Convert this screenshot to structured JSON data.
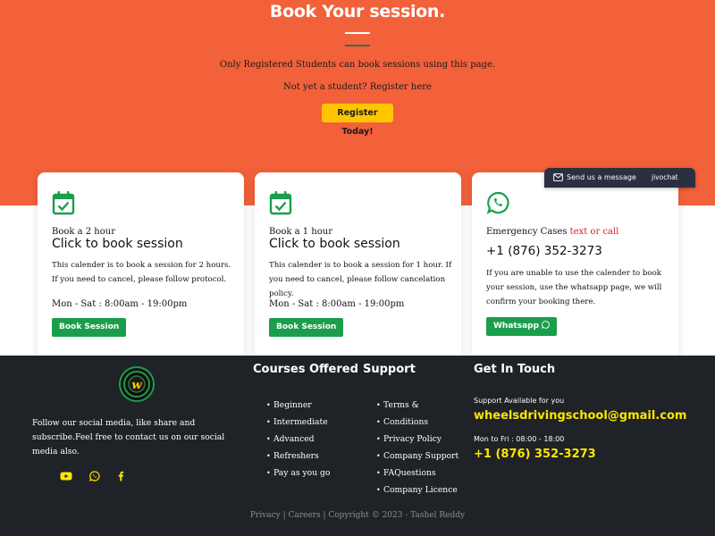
{
  "hero": {
    "title": "Book Your session.",
    "line1": "Only Registered Students can book sessions using this page.",
    "line2": "Not yet a student? Register here",
    "register_button": "Register Today!"
  },
  "cards": [
    {
      "icon": "calendar-check-icon",
      "small": "Book a 2 hour",
      "big": "Click to book session",
      "text": "This calender is to book a session for 2 hours. If you need to cancel, please follow protocol.",
      "hours": "Mon - Sat : 8:00am - 19:00pm",
      "button": "Book Session"
    },
    {
      "icon": "calendar-check-icon",
      "small": "Book a 1 hour",
      "big": "Click to book session",
      "text": "This calender is to book a session for 1 hour. If you need to cancel, please follow cancelation policy.",
      "hours": "Mon - Sat : 8:00am - 19:00pm",
      "button": "Book Session"
    },
    {
      "icon": "whatsapp-icon",
      "small": "Emergency Cases",
      "small_red": "text or call",
      "phone": "+1 (876) 352-3273",
      "text": "If you are unable to use the calender to book your session, use the whatsapp page, we will confirm your booking there.",
      "button": "Whatsapp"
    }
  ],
  "chat_widget": {
    "label": "Send us a message",
    "brand": "jivochat"
  },
  "footer": {
    "about": "Follow our social media, like share and subscribe.Feel free to contact us on our social media also.",
    "socials": [
      "youtube-icon",
      "whatsapp-icon",
      "facebook-icon"
    ],
    "courses_title": "Courses Offered",
    "courses": [
      "Beginner",
      "Intermediate",
      "Advanced",
      "Refreshers",
      "Pay as you go"
    ],
    "support_title": "Support",
    "support": [
      "Terms &",
      "Conditions",
      "Privacy Policy",
      "Company Support",
      "FAQuestions",
      "Company Licence"
    ],
    "contact_title": "Get In Touch",
    "support_available": "Support Available for you",
    "email": "wheelsdrivingschool@gmail.com",
    "hours": "Mon to Fri : 08:00 - 18:00",
    "phone": "+1 (876) 352-3273",
    "copyright": "Privacy | Careers  | Copyright © 2023 - Tashel Reddy"
  },
  "colors": {
    "hero_bg": "#f2613a",
    "button_yellow": "#ffc600",
    "button_green": "#1b9e4b",
    "footer_bg": "#1f2227",
    "highlight_yellow": "#ffe600",
    "emergency_red": "#e0202a"
  }
}
